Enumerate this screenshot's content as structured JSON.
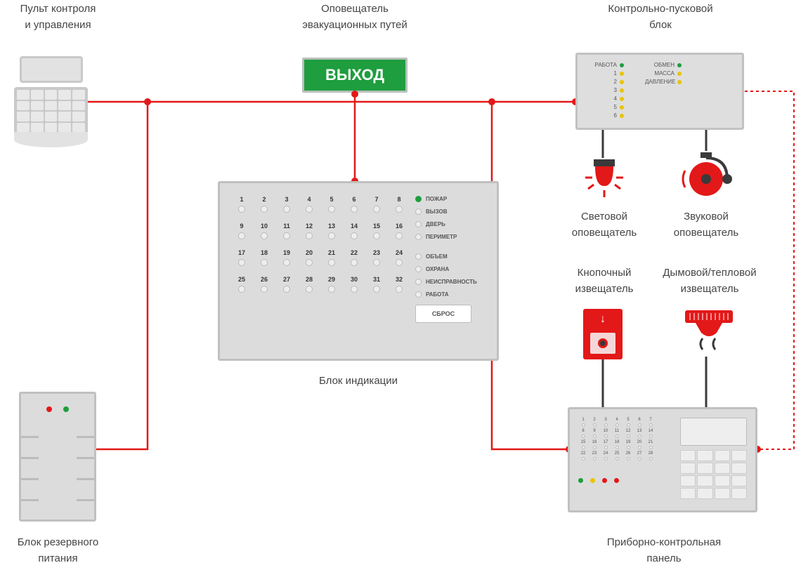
{
  "labels": {
    "control_keypad": "Пульт контроля\nи управления",
    "exit_notifier": "Оповещатель\nэвакуационных путей",
    "control_launch_block": "Контрольно-пусковой\nблок",
    "indication_block": "Блок индикации",
    "light_notifier": "Световой\nоповещатель",
    "sound_notifier": "Звуковой\nоповещатель",
    "button_detector": "Кнопочный\nизвещатель",
    "smoke_detector": "Дымовой/тепловой\nизвещатель",
    "backup_power": "Блок резервного\nпитания",
    "control_panel": "Приборно-контрольная\nпанель"
  },
  "exit_sign_text": "ВЫХОД",
  "indication_block": {
    "zones": [
      1,
      2,
      3,
      4,
      5,
      6,
      7,
      8,
      9,
      10,
      11,
      12,
      13,
      14,
      15,
      16,
      17,
      18,
      19,
      20,
      21,
      22,
      23,
      24,
      25,
      26,
      27,
      28,
      29,
      30,
      31,
      32
    ],
    "statuses": [
      "ПОЖАР",
      "ВЫЗОВ",
      "ДВЕРЬ",
      "ПЕРИМЕТР",
      "ОБЪЕМ",
      "ОХРАНА",
      "НЕИСПРАВНОСТЬ",
      "РАБОТА"
    ],
    "active_green_status_index": 0,
    "reset_button": "СБРОС"
  },
  "control_launch_block": {
    "left_items": [
      {
        "label": "РАБОТА",
        "led": "green"
      },
      {
        "label": "1",
        "led": "yellow"
      },
      {
        "label": "2",
        "led": "yellow"
      },
      {
        "label": "3",
        "led": "yellow"
      },
      {
        "label": "4",
        "led": "yellow"
      },
      {
        "label": "5",
        "led": "yellow"
      },
      {
        "label": "6",
        "led": "yellow"
      }
    ],
    "right_items": [
      {
        "label": "ОБМЕН",
        "led": "green"
      },
      {
        "label": "МАССА",
        "led": "yellow"
      },
      {
        "label": "ДАВЛЕНИЕ",
        "led": "yellow"
      }
    ]
  },
  "control_panel_zones": [
    1,
    2,
    3,
    4,
    5,
    6,
    7,
    8,
    9,
    10,
    11,
    12,
    13,
    14,
    15,
    16,
    17,
    18,
    19,
    20,
    21,
    22,
    23,
    24,
    25,
    26,
    27,
    28
  ],
  "colors": {
    "wire": "#e31818",
    "device_wire": "#3a3a3a",
    "green": "#1e9e3e",
    "yellow": "#e8c400"
  }
}
